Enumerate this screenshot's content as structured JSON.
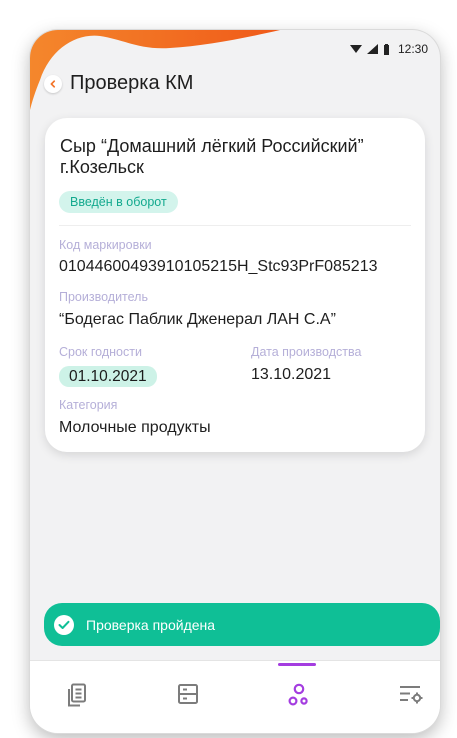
{
  "status_bar": {
    "time": "12:30"
  },
  "header": {
    "title": "Проверка КМ"
  },
  "product": {
    "title": "Сыр “Домашний лёгкий Российский” г.Козельск",
    "status_badge": "Введён в оборот"
  },
  "fields": {
    "code_label": "Код маркировки",
    "code_value": "0104460049391010521​5H_Stc93PrF085213",
    "producer_label": "Производитель",
    "producer_value": "“Бодегас Паблик Дженерал ЛАН С.А”",
    "expiry_label": "Срок годности",
    "expiry_value": "01.10.2021",
    "production_label": "Дата производства",
    "production_value": "13.10.2021",
    "category_label": "Категория",
    "category_value": "Молочные продукты"
  },
  "toast": {
    "text": "Проверка пройдена"
  },
  "bottom_nav": {
    "items": [
      "documents-icon",
      "registry-icon",
      "scan-check-icon",
      "settings-icon"
    ],
    "active_index": 2
  },
  "colors": {
    "accent_purple": "#a43de0",
    "success_green": "#0fbf96",
    "badge_bg": "#d3f4ec",
    "header_wave": "#f26b1d"
  }
}
